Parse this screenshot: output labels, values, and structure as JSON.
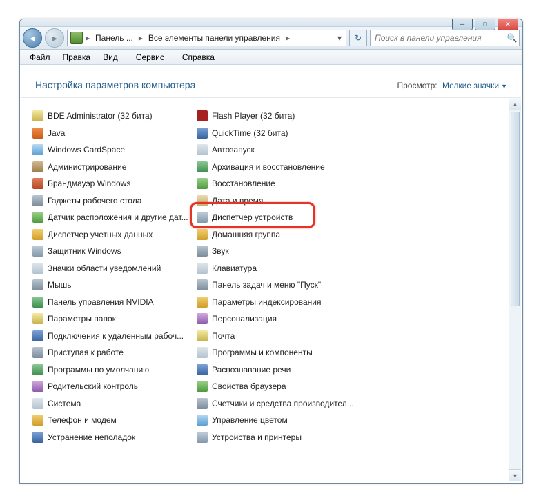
{
  "breadcrumb": [
    "Панель ...",
    "Все элементы панели управления"
  ],
  "search": {
    "placeholder": "Поиск в панели управления"
  },
  "menu": [
    "Файл",
    "Правка",
    "Вид",
    "Сервис",
    "Справка"
  ],
  "header": {
    "title": "Настройка параметров компьютера",
    "view_label": "Просмотр:",
    "view_value": "Мелкие значки"
  },
  "highlighted_item": "Диспетчер устройств",
  "columns": [
    [
      {
        "label": "BDE Administrator (32 бита)",
        "icon": "c1"
      },
      {
        "label": "Java",
        "icon": "c2"
      },
      {
        "label": "Windows CardSpace",
        "icon": "c3"
      },
      {
        "label": "Администрирование",
        "icon": "c4"
      },
      {
        "label": "Брандмауэр Windows",
        "icon": "c5"
      },
      {
        "label": "Гаджеты рабочего стола",
        "icon": "c6"
      },
      {
        "label": "Датчик расположения и другие дат...",
        "icon": "c7"
      },
      {
        "label": "Диспетчер учетных данных",
        "icon": "c8"
      },
      {
        "label": "Защитник Windows",
        "icon": "c15"
      },
      {
        "label": "Значки области уведомлений",
        "icon": "c9"
      },
      {
        "label": "Мышь",
        "icon": "c6"
      },
      {
        "label": "Панель управления NVIDIA",
        "icon": "c10"
      },
      {
        "label": "Параметры папок",
        "icon": "c1"
      },
      {
        "label": "Подключения к удаленным рабоч...",
        "icon": "c13"
      },
      {
        "label": "Приступая к работе",
        "icon": "c6"
      },
      {
        "label": "Программы по умолчанию",
        "icon": "c10"
      },
      {
        "label": "Родительский контроль",
        "icon": "c11"
      },
      {
        "label": "Система",
        "icon": "c9"
      },
      {
        "label": "Телефон и модем",
        "icon": "c8"
      },
      {
        "label": "Устранение неполадок",
        "icon": "c13"
      }
    ],
    [
      {
        "label": "Flash Player (32 бита)",
        "icon": "c12"
      },
      {
        "label": "QuickTime (32 бита)",
        "icon": "c13"
      },
      {
        "label": "Автозапуск",
        "icon": "c9"
      },
      {
        "label": "Архивация и восстановление",
        "icon": "c10"
      },
      {
        "label": "Восстановление",
        "icon": "c7"
      },
      {
        "label": "Дата и время",
        "icon": "c14"
      },
      {
        "label": "Диспетчер устройств",
        "icon": "c15"
      },
      {
        "label": "Домашняя группа",
        "icon": "c8"
      },
      {
        "label": "Звук",
        "icon": "c6"
      },
      {
        "label": "Клавиатура",
        "icon": "c9"
      },
      {
        "label": "Панель задач и меню \"Пуск\"",
        "icon": "c6"
      },
      {
        "label": "Параметры индексирования",
        "icon": "c8"
      },
      {
        "label": "Персонализация",
        "icon": "c11"
      },
      {
        "label": "Почта",
        "icon": "c1"
      },
      {
        "label": "Программы и компоненты",
        "icon": "c9"
      },
      {
        "label": "Распознавание речи",
        "icon": "c13"
      },
      {
        "label": "Свойства браузера",
        "icon": "c7"
      },
      {
        "label": "Счетчики и средства производител...",
        "icon": "c6"
      },
      {
        "label": "Управление цветом",
        "icon": "c3"
      },
      {
        "label": "Устройства и принтеры",
        "icon": "c15"
      }
    ]
  ]
}
